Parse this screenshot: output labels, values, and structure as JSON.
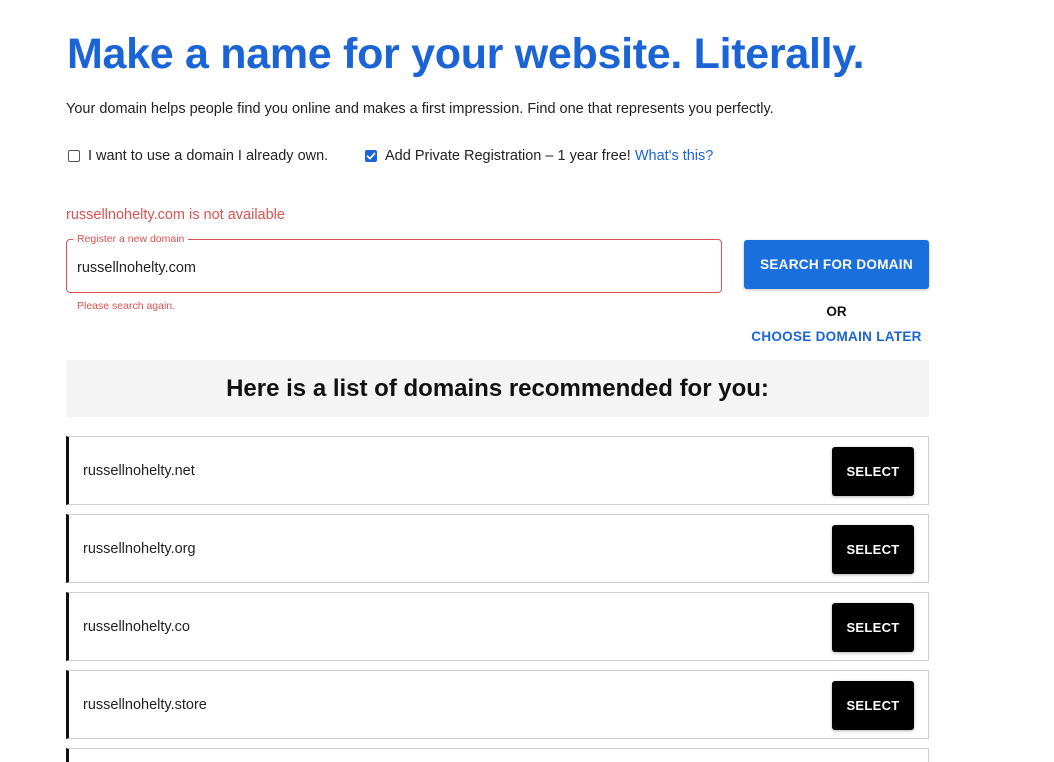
{
  "header": {
    "title": "Make a name for your website. Literally.",
    "subtitle": "Your domain helps people find you online and makes a first impression. Find one that represents you perfectly."
  },
  "options": {
    "own_domain": {
      "label": "I want to use a domain I already own.",
      "checked": false
    },
    "private_registration": {
      "label": "Add Private Registration – 1 year free!",
      "checked": true,
      "link": "What's this?"
    }
  },
  "search": {
    "status_message": "russellnohelty.com is not available",
    "field_label": "Register a new domain",
    "value": "russellnohelty.com",
    "helper_text": "Please search again.",
    "search_button": "SEARCH FOR DOMAIN",
    "or_text": "OR",
    "later_link": "CHOOSE DOMAIN LATER"
  },
  "recommendations": {
    "heading": "Here is a list of domains recommended for you:",
    "select_label": "SELECT",
    "domains": [
      "russellnohelty.net",
      "russellnohelty.org",
      "russellnohelty.co",
      "russellnohelty.store"
    ]
  },
  "colors": {
    "accent": "#1a64d6",
    "error": "#d9534f",
    "select_button": "#000000"
  }
}
